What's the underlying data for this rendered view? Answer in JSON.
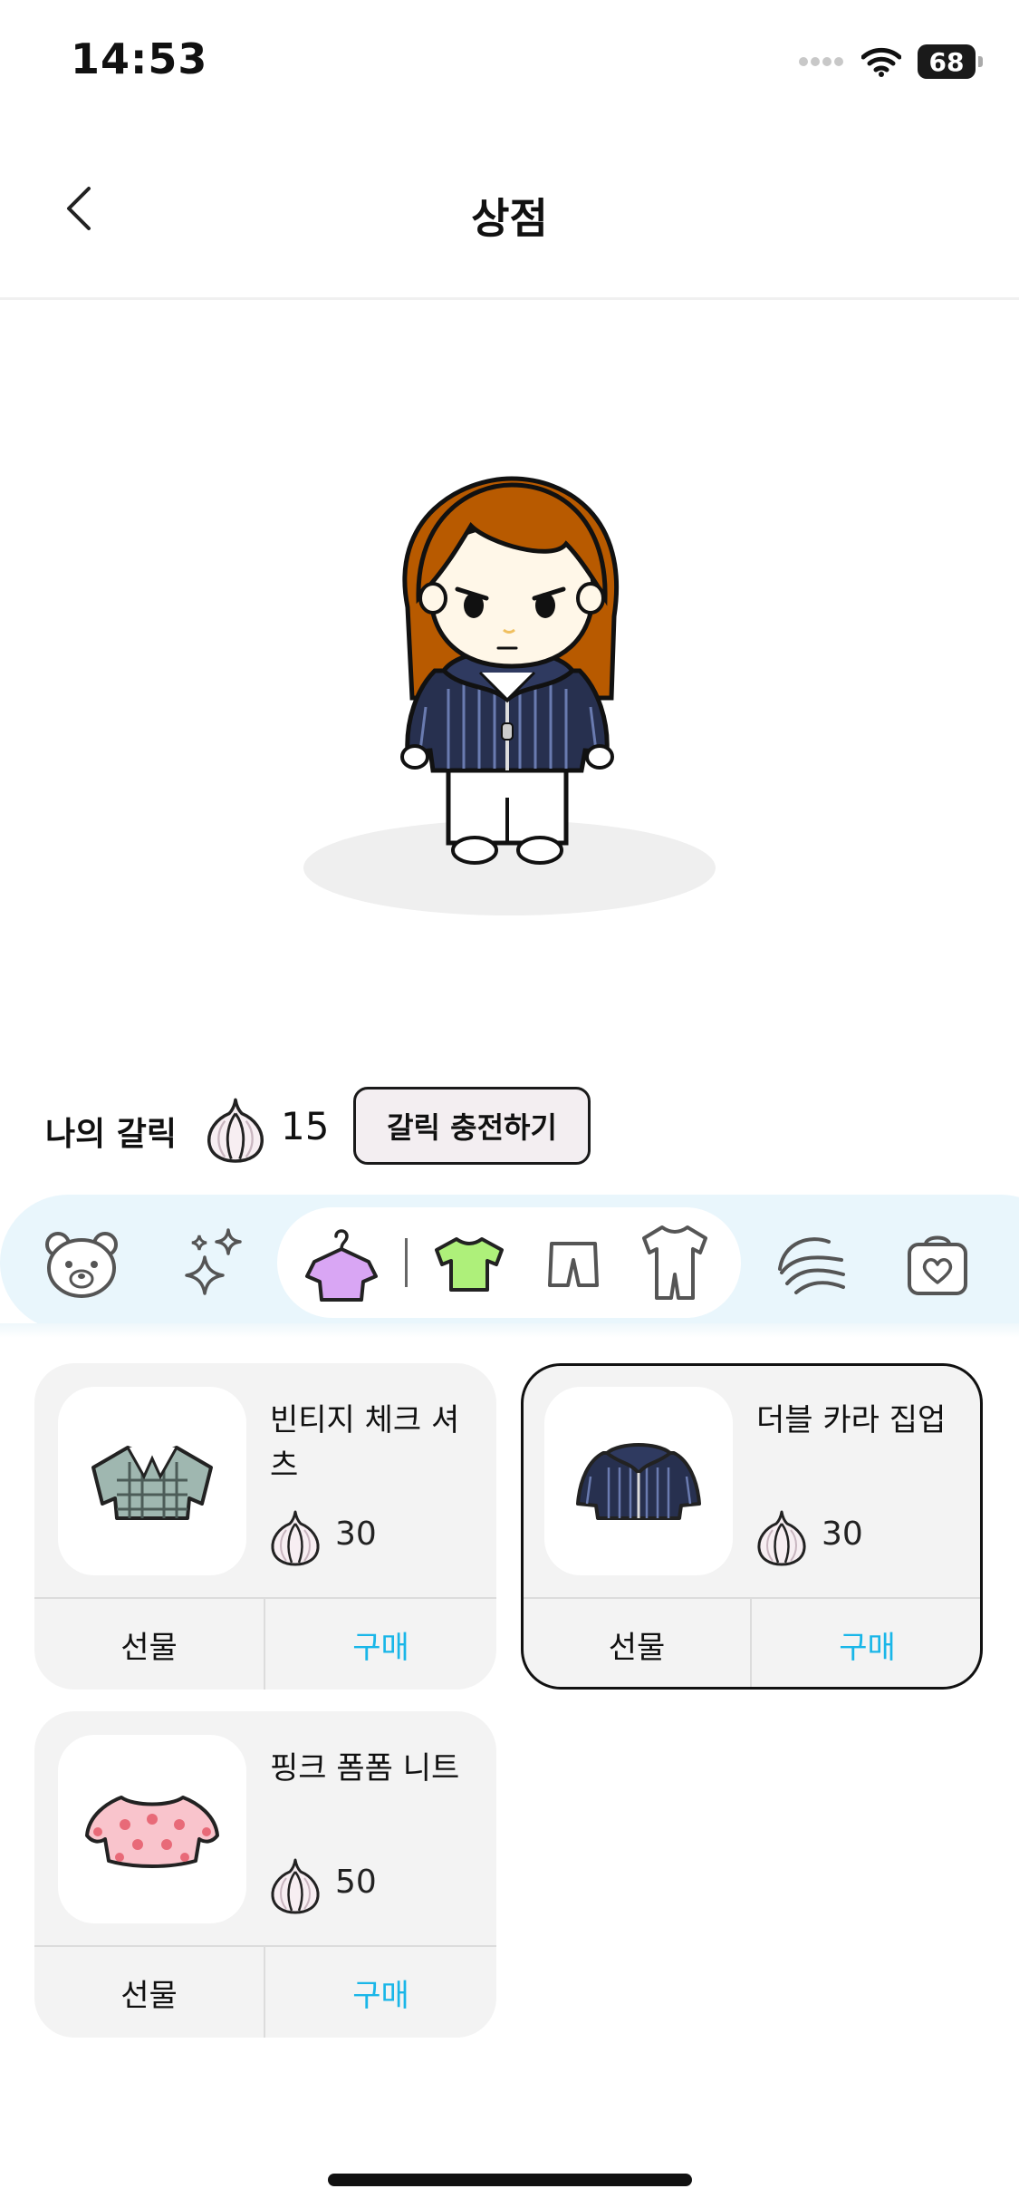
{
  "status_bar": {
    "time": "14:53",
    "battery": "68"
  },
  "header": {
    "title": "상점"
  },
  "garlic": {
    "label": "나의 갈릭",
    "count": "15",
    "charge_button": "갈릭 충전하기"
  },
  "categories": [
    {
      "name": "bear-icon"
    },
    {
      "name": "sparkles-icon"
    },
    {
      "name": "hanger-shirt-icon",
      "selected": true
    },
    {
      "name": "tshirt-icon"
    },
    {
      "name": "shorts-icon"
    },
    {
      "name": "romper-icon"
    },
    {
      "name": "hair-icon"
    },
    {
      "name": "bag-heart-icon"
    }
  ],
  "items": [
    {
      "name": "빈티지 체크 셔츠",
      "price": "30",
      "gift": "선물",
      "buy": "구매",
      "selected": false
    },
    {
      "name": "더블 카라 집업",
      "price": "30",
      "gift": "선물",
      "buy": "구매",
      "selected": true
    },
    {
      "name": "핑크 폼폼 니트",
      "price": "50",
      "gift": "선물",
      "buy": "구매",
      "selected": false
    }
  ],
  "colors": {
    "accent": "#19b6e8",
    "category_bar": "#e9f6fc",
    "card_bg": "#f3f3f3"
  }
}
